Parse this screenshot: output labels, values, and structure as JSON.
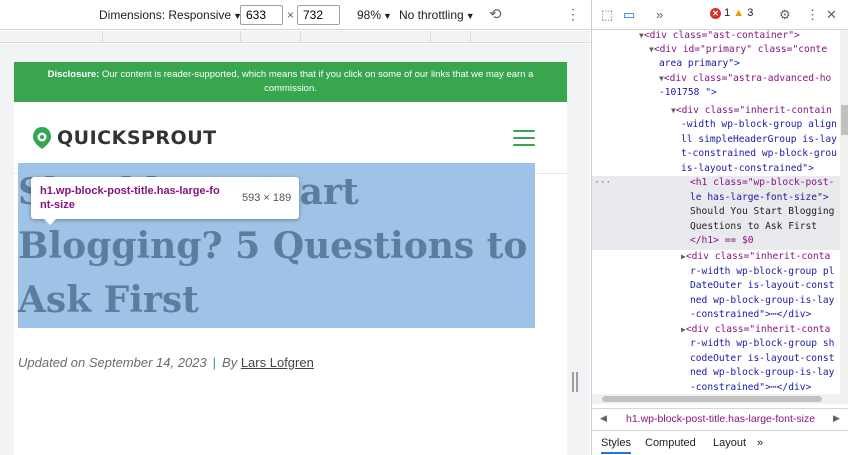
{
  "devbar": {
    "dimensions_label": "Dimensions: Responsive",
    "width_value": "633",
    "times": "×",
    "height_value": "732",
    "zoom": "98%",
    "throttle": "No throttling"
  },
  "page": {
    "disclosure_bold": "Disclosure:",
    "disclosure_text": "Our content is reader-supported, which means that if you click on some of our links that we may earn a commission.",
    "logo_text": "QUICKSPROUT",
    "title_line1": "Should You Start",
    "title_line2": "Blogging? 5 Questions to",
    "title_line3": "Ask First",
    "updated_text": "Updated on September 14, 2023",
    "sep": "|",
    "by": "By",
    "author": "Lars Lofgren"
  },
  "tooltip": {
    "selector_line1": "h1.wp-block-post-title.has-large-fo",
    "selector_line2": "nt-size",
    "size": "593 × 189"
  },
  "devtools": {
    "errors": "1",
    "warnings": "3",
    "dom_lines": [
      "<div class=\"ast-container\">",
      "<div id=\"primary\" class=\"conte",
      "area primary\">",
      "<div class=\"astra-advanced-ho",
      "-101758 \">",
      "<div class=\"inherit-contain",
      "-width wp-block-group align",
      "ll simpleHeaderGroup is-lay",
      "t-constrained wp-block-grou",
      "is-layout-constrained\">",
      "<h1 class=\"wp-block-post-",
      "le has-large-font-size\">",
      "Should You Start Blogging",
      "Questions to Ask First",
      "</h1> == $0",
      "<div class=\"inherit-conta",
      "r-width wp-block-group pl",
      "DateOuter is-layout-const",
      "ned wp-block-group-is-lay",
      "-constrained\">⋯</div>",
      "<div class=\"inherit-conta",
      "r-width wp-block-group sh",
      "codeOuter is-layout-const",
      "ned wp-block-group-is-lay",
      "-constrained\">⋯</div>"
    ],
    "breadcrumb": "h1.wp-block-post-title.has-large-font-size",
    "tabs": [
      "Styles",
      "Computed",
      "Layout"
    ],
    "more_tabs": "»"
  },
  "colors": {
    "accent_green": "#37a64f",
    "selection_highlight": "#9fc3e7",
    "tag_purple": "#881280"
  }
}
